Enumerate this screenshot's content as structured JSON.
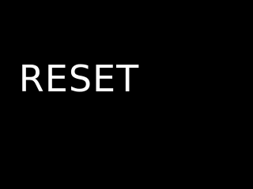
{
  "screen": {
    "background_color": "#000000"
  },
  "reset_button": {
    "label": "RESET",
    "text_color": "#ffffff"
  }
}
